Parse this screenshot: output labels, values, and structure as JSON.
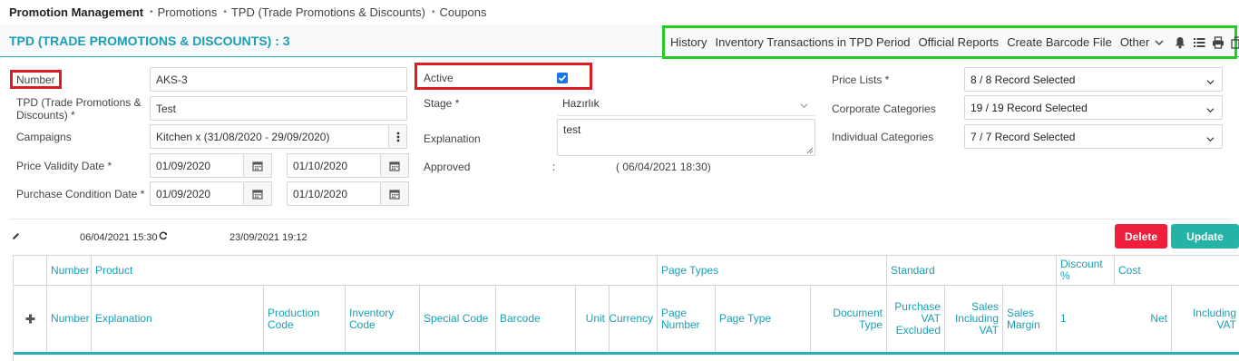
{
  "breadcrumb": {
    "items": [
      "Promotion Management",
      "Promotions",
      "TPD (Trade Promotions & Discounts)",
      "Coupons"
    ]
  },
  "page": {
    "title": "TPD (TRADE PROMOTIONS & DISCOUNTS) : 3"
  },
  "toolbar": {
    "history": "History",
    "inventory_transactions": "Inventory Transactions in TPD Period",
    "official_reports": "Official Reports",
    "create_barcode": "Create Barcode File",
    "other": "Other",
    "icons": [
      "bell-icon",
      "list-icon",
      "print-icon",
      "copy-icon",
      "plus-icon",
      "check-icon"
    ]
  },
  "form": {
    "number_label": "Number",
    "number_value": "AKS-3",
    "tpd_label": "TPD (Trade Promotions & Discounts) *",
    "tpd_value": "Test",
    "campaigns_label": "Campaigns",
    "campaigns_value": "Kitchen x (31/08/2020 - 29/09/2020)",
    "price_validity_label": "Price Validity Date *",
    "price_validity_from": "01/09/2020",
    "price_validity_to": "01/10/2020",
    "purchase_condition_label": "Purchase Condition Date *",
    "purchase_condition_from": "01/09/2020",
    "purchase_condition_to": "01/10/2020",
    "active_label": "Active",
    "active_checked": true,
    "stage_label": "Stage *",
    "stage_value": "Hazırlık",
    "explanation_label": "Explanation",
    "explanation_value": "test",
    "approved_label": "Approved",
    "approved_colon": ":",
    "approved_value": "( 06/04/2021 18:30)",
    "price_lists_label": "Price Lists *",
    "price_lists_value": "8 / 8 Record Selected",
    "corporate_categories_label": "Corporate Categories",
    "corporate_categories_value": "19 / 19 Record Selected",
    "individual_categories_label": "Individual Categories",
    "individual_categories_value": "7 / 7 Record Selected"
  },
  "record_info": {
    "created": "06/04/2021 15:30",
    "updated": "23/09/2021 19:12"
  },
  "actions": {
    "delete": "Delete",
    "update": "Update"
  },
  "colors": {
    "accent": "#1a9fb2",
    "delete": "#ef1f3c",
    "update": "#24b3a6",
    "highlight_red": "#dd1c24",
    "highlight_green": "#22cc22"
  },
  "table": {
    "group_headers": {
      "number": "Number",
      "product": "Product",
      "page_types": "Page Types",
      "standard": "Standard",
      "discount": "Discount %",
      "cost": "Cost"
    },
    "columns": {
      "number": "Number",
      "explanation": "Explanation",
      "production_code": "Production Code",
      "inventory_code": "Inventory Code",
      "special_code": "Special Code",
      "barcode": "Barcode",
      "unit": "Unit",
      "currency": "Currency",
      "page_number": "Page Number",
      "page_type": "Page Type",
      "document_type": "Document Type",
      "purchase_vat_excluded": "Purchase VAT Excluded",
      "sales_including_vat": "Sales Including VAT",
      "sales_margin": "Sales Margin",
      "discount_1": "1",
      "net": "Net",
      "including_vat": "Including VAT"
    }
  }
}
